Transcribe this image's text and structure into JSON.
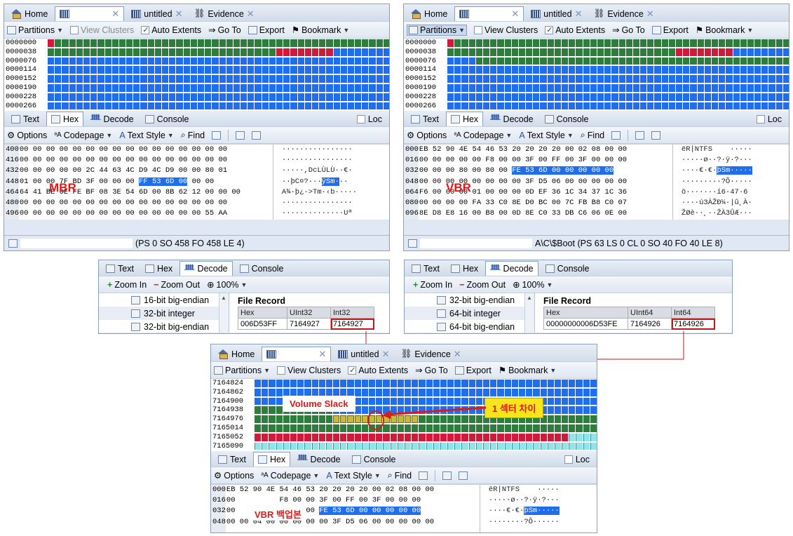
{
  "tabs": {
    "home": "Home",
    "untitled": "untitled",
    "evidence": "Evidence",
    "close": "✕"
  },
  "toolbar": {
    "partitions": "Partitions",
    "view_clusters": "View Clusters",
    "auto_extents": "Auto Extents",
    "goto": "Go To",
    "export": "Export",
    "bookmark": "Bookmark"
  },
  "viewtabs": {
    "text": "Text",
    "hex": "Hex",
    "decode": "Decode",
    "console": "Console",
    "lock": "Loc"
  },
  "hextoolbar": {
    "options": "Options",
    "codepage": "Codepage",
    "textstyle": "Text Style",
    "find": "Find"
  },
  "decodetoolbar": {
    "zoomin": "Zoom In",
    "zoomout": "Zoom Out",
    "zoom": "100%"
  },
  "mbr_pane": {
    "addresses": [
      "0000000",
      "0000038",
      "0000076",
      "0000114",
      "0000152",
      "0000190",
      "0000228",
      "0000266"
    ],
    "hex_offsets": [
      "400",
      "416",
      "432",
      "448",
      "464",
      "480",
      "496"
    ],
    "hex_rows": [
      "00 00 00 00 00 00 00 00 00 00 00 00 00 00 00 00",
      "00 00 00 00 00 00 00 00 00 00 00 00 00 00 00 00",
      "00 00 00 00 00 2C 44 63 4C D9 4C D9 00 00 80 01",
      "01 00 00 7F BD 3F 00 00 00 ",
      "64 41 BE 0E FE BF 08 3E 54 6D 00 8B 62 12 00 00 00",
      "00 00 00 00 00 00 00 00 00 00 00 00 00 00 00 00",
      "00 00 00 00 00 00 00 00 00 00 00 00 00 00 55 AA"
    ],
    "hex_sel": "FF 53 6D 00",
    "hex_after": " 00 00",
    "ascii": [
      "················",
      "················",
      "·····,DcLÙLÙ··€·",
      "··þC¤?···",
      "A¾·þ¿·>Tm·‹b·····",
      "················",
      "··············Uª"
    ],
    "ascii_sel": "ÿSm·",
    "ascii_after": "··",
    "label": "MBR",
    "status": "(PS 0 SO 458 FO 458 LE 4)"
  },
  "vbr_pane": {
    "addresses": [
      "0000000",
      "0000038",
      "0000076",
      "0000114",
      "0000152",
      "0000190",
      "0000228",
      "0000266"
    ],
    "hex_offsets": [
      "000",
      "016",
      "032",
      "048",
      "064",
      "080",
      "096"
    ],
    "hex_rows": [
      "EB 52 90 4E 54 46 53 20 20 20 20 00 02 08 00 00",
      "00 00 00 00 00 F8 00 00 3F 00 FF 00 3F 00 00 00",
      "00 00 00 80 00 80 00 ",
      "00 00 00 00 00 00 00 00 3F D5 06 00 00 00 00 00",
      "F6 00 00 00 01 00 00 00 0D EF 36 1C 34 37 1C 36",
      "00 00 00 00 FA 33 C0 8E D0 BC 00 7C FB B8 C0 07",
      "8E D8 E8 16 00 B8 00 0D 8E C0 33 DB C6 06 0E 00"
    ],
    "hex_sel": "FE 53 6D 00 00 00 00 00",
    "ascii": [
      "ëR|NTFS    ·····",
      "·····ø··?·ÿ·?···",
      "····€·€·",
      "·········?Õ·····",
      "ö·······í6·47·6",
      "····ú3ÀŽÐ¼·|û¸À·",
      "ŽØè··¸··ŽÀ3ÛÆ···"
    ],
    "ascii_sel": "þSm·····",
    "label": "VBR",
    "status": "A\\C\\$Boot (PS 63  LS 0  CL 0 SO 40 FO 40 LE 8)"
  },
  "decode_left": {
    "tree": [
      "16-bit big-endian",
      "32-bit integer",
      "32-bit big-endian"
    ],
    "record_title": "File Record",
    "headers": [
      "Hex",
      "UInt32",
      "Int32"
    ],
    "values": [
      "006D53FF",
      "7164927",
      "7164927"
    ]
  },
  "decode_right": {
    "tree": [
      "32-bit big-endian",
      "64-bit integer",
      "64-bit big-endian"
    ],
    "record_title": "File Record",
    "headers": [
      "Hex",
      "UInt64",
      "Int64"
    ],
    "values": [
      "00000000006D53FE",
      "7164926",
      "7164926"
    ]
  },
  "bottom_pane": {
    "addresses": [
      "7164824",
      "7164862",
      "7164900",
      "7164938",
      "7164976",
      "7165014",
      "7165052",
      "7165090"
    ],
    "volume_slack": "Volume Slack",
    "sector_diff": "1 섹터 차이",
    "hex_offsets": [
      "000",
      "016",
      "032",
      "048"
    ],
    "hex_rows": [
      "EB 52 90 4E 54 46 53 20 20 20 20 00 02 08 00 00",
      "00          F8 00 00 3F 00 FF 00 3F 00 00 00",
      "00          00 80 00 ",
      "00 00 04 00 00 00 00 00 3F D5 06 00 00 00 00 00"
    ],
    "hex_sel": "FE 53 6D 00 00 00 00 00",
    "ascii": [
      "ëR|NTFS    ·····",
      "·····ø··?·ÿ·?···",
      "····€·€·",
      "········?Õ······"
    ],
    "ascii_sel": "þSm·····",
    "label": "VBR 백업본"
  },
  "colors": {
    "cluster_blue": "#1f6ef0",
    "cluster_green": "#2e7d3c",
    "cluster_red": "#d2193b",
    "slack_yellow": "#c7bb35",
    "annotation_red": "#e01818"
  }
}
